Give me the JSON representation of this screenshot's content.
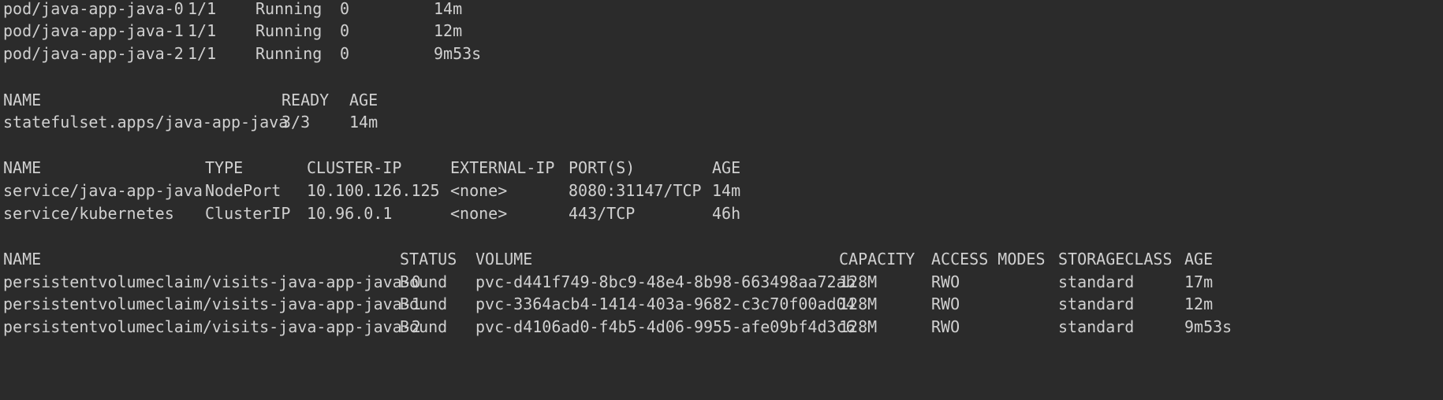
{
  "pods": [
    {
      "name": "pod/java-app-java-0",
      "ready": "1/1",
      "status": "Running",
      "restarts": "0",
      "age": "14m"
    },
    {
      "name": "pod/java-app-java-1",
      "ready": "1/1",
      "status": "Running",
      "restarts": "0",
      "age": "12m"
    },
    {
      "name": "pod/java-app-java-2",
      "ready": "1/1",
      "status": "Running",
      "restarts": "0",
      "age": "9m53s"
    }
  ],
  "statefulset": {
    "headers": {
      "name": "NAME",
      "ready": "READY",
      "age": "AGE"
    },
    "rows": [
      {
        "name": "statefulset.apps/java-app-java",
        "ready": "3/3",
        "age": "14m"
      }
    ]
  },
  "services": {
    "headers": {
      "name": "NAME",
      "type": "TYPE",
      "cluster_ip": "CLUSTER-IP",
      "external_ip": "EXTERNAL-IP",
      "ports": "PORT(S)",
      "age": "AGE"
    },
    "rows": [
      {
        "name": "service/java-app-java",
        "type": "NodePort",
        "cluster_ip": "10.100.126.125",
        "external_ip": "<none>",
        "ports": "8080:31147/TCP",
        "age": "14m"
      },
      {
        "name": "service/kubernetes",
        "type": "ClusterIP",
        "cluster_ip": "10.96.0.1",
        "external_ip": "<none>",
        "ports": "443/TCP",
        "age": "46h"
      }
    ]
  },
  "pvcs": {
    "headers": {
      "name": "NAME",
      "status": "STATUS",
      "volume": "VOLUME",
      "capacity": "CAPACITY",
      "access_modes": "ACCESS MODES",
      "storageclass": "STORAGECLASS",
      "age": "AGE"
    },
    "rows": [
      {
        "name": "persistentvolumeclaim/visits-java-app-java-0",
        "status": "Bound",
        "volume": "pvc-d441f749-8bc9-48e4-8b98-663498aa72ab",
        "capacity": "128M",
        "access_modes": "RWO",
        "storageclass": "standard",
        "age": "17m"
      },
      {
        "name": "persistentvolumeclaim/visits-java-app-java-1",
        "status": "Bound",
        "volume": "pvc-3364acb4-1414-403a-9682-c3c70f00ad04",
        "capacity": "128M",
        "access_modes": "RWO",
        "storageclass": "standard",
        "age": "12m"
      },
      {
        "name": "persistentvolumeclaim/visits-java-app-java-2",
        "status": "Bound",
        "volume": "pvc-d4106ad0-f4b5-4d06-9955-afe09bf4d3c6",
        "capacity": "128M",
        "access_modes": "RWO",
        "storageclass": "standard",
        "age": "9m53s"
      }
    ]
  },
  "colors": {
    "background": "#2b2b2b",
    "text": "#d0d0d0"
  }
}
